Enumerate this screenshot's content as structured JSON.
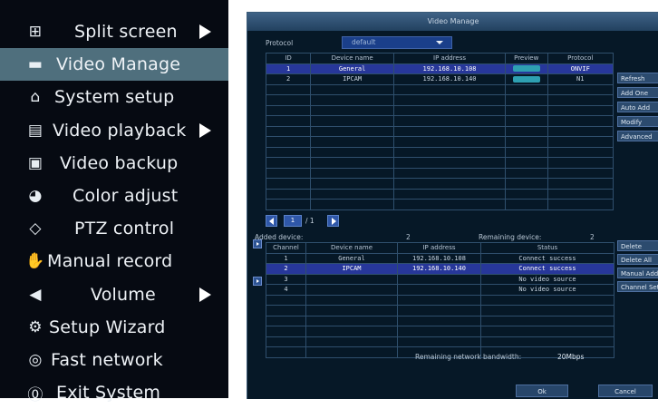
{
  "menu": {
    "items": [
      {
        "label": "Split screen",
        "icon": "split-screen-icon",
        "arrow": true
      },
      {
        "label": "Video Manage",
        "icon": "camera-icon",
        "selected": true
      },
      {
        "label": "System setup",
        "icon": "home-icon"
      },
      {
        "label": "Video playback",
        "icon": "playback-icon",
        "arrow": true
      },
      {
        "label": "Video backup",
        "icon": "floppy-icon"
      },
      {
        "label": "Color adjust",
        "icon": "palette-icon"
      },
      {
        "label": "PTZ control",
        "icon": "ptz-icon"
      },
      {
        "label": "Manual record",
        "icon": "hand-icon"
      },
      {
        "label": "Volume",
        "icon": "speaker-icon",
        "arrow": true
      },
      {
        "label": "Setup Wizard",
        "icon": "wizard-icon"
      },
      {
        "label": "Fast network",
        "icon": "globe-icon"
      },
      {
        "label": "Exit System",
        "icon": "power-icon"
      }
    ]
  },
  "dialog": {
    "title": "Video Manage",
    "protocol_label": "Protocol",
    "protocol_value": "default",
    "search_table": {
      "headers": [
        "ID",
        "Device name",
        "IP address",
        "Preview",
        "Protocol"
      ],
      "rows": [
        [
          "1",
          "General",
          "192.168.10.108",
          "",
          "ONVIF"
        ],
        [
          "2",
          "IPCAM",
          "192.168.10.140",
          "",
          "N1"
        ]
      ]
    },
    "right_buttons": [
      "Refresh",
      "Add One",
      "Auto Add",
      "Modify",
      "Advanced"
    ],
    "pager": {
      "current": "1",
      "total": "/ 1"
    },
    "added_label": "Added device:",
    "added_count": "2",
    "remaining_label": "Remaining device:",
    "remaining_count": "2",
    "added_table": {
      "headers": [
        "Channel",
        "Device name",
        "IP address",
        "Status"
      ],
      "rows": [
        [
          "1",
          "General",
          "192.168.10.108",
          "Connect success"
        ],
        [
          "2",
          "IPCAM",
          "192.168.10.140",
          "Connect success"
        ],
        [
          "3",
          "",
          "",
          "No video source"
        ],
        [
          "4",
          "",
          "",
          "No video source"
        ]
      ]
    },
    "lower_buttons": [
      "Delete",
      "Delete All",
      "Manual Add",
      "Channel Set"
    ],
    "bandwidth_label": "Remaining network bandwidth:",
    "bandwidth_value": "20Mbps",
    "ok_label": "Ok",
    "cancel_label": "Cancel"
  },
  "colors": {
    "selected_menu": "#4f6f7d",
    "highlight_row": "#27379a",
    "preview": "#2ea0b2"
  }
}
